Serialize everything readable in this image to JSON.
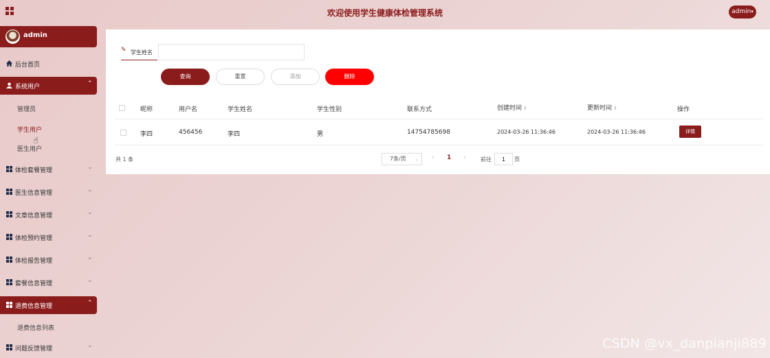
{
  "header": {
    "title": "欢迎使用学生健康体检管理系统",
    "user_label": "admin"
  },
  "sidebar": {
    "profile_name": "admin",
    "items": [
      {
        "label": "后台首页"
      },
      {
        "label": "系统用户",
        "sub": [
          "管理员",
          "学生用户",
          "医生用户"
        ]
      },
      {
        "label": "体检套餐管理"
      },
      {
        "label": "医生信息管理"
      },
      {
        "label": "文章信息管理"
      },
      {
        "label": "体检预约管理"
      },
      {
        "label": "体检报告管理"
      },
      {
        "label": "套餐信息管理"
      },
      {
        "label": "退费信息管理",
        "sub": [
          "退费信息列表"
        ]
      },
      {
        "label": "问题反馈管理"
      }
    ]
  },
  "search": {
    "label": "学生姓名",
    "value": "",
    "placeholder": ""
  },
  "buttons": {
    "query": "查询",
    "reset": "重置",
    "add": "添加",
    "delete": "删除"
  },
  "table": {
    "columns": [
      "昵称",
      "用户名",
      "学生姓名",
      "学生性别",
      "联系方式",
      "创建时间",
      "更新时间",
      "操作"
    ],
    "rows": [
      {
        "nickname": "李四",
        "username": "456456",
        "student_name": "李四",
        "gender": "男",
        "contact": "14754785698",
        "created": "2024-03-26 11:36:46",
        "updated": "2024-03-26 11:36:46",
        "action": "详情"
      }
    ]
  },
  "pagination": {
    "total": "共 1 条",
    "page_size": "7条/页",
    "current_page": "1",
    "goto_prefix": "前往",
    "goto_value": "1",
    "goto_suffix": "页"
  },
  "watermark": "CSDN @vx_danpianji889",
  "colors": {
    "brand": "#8b1c1c",
    "danger": "#ff0000"
  }
}
